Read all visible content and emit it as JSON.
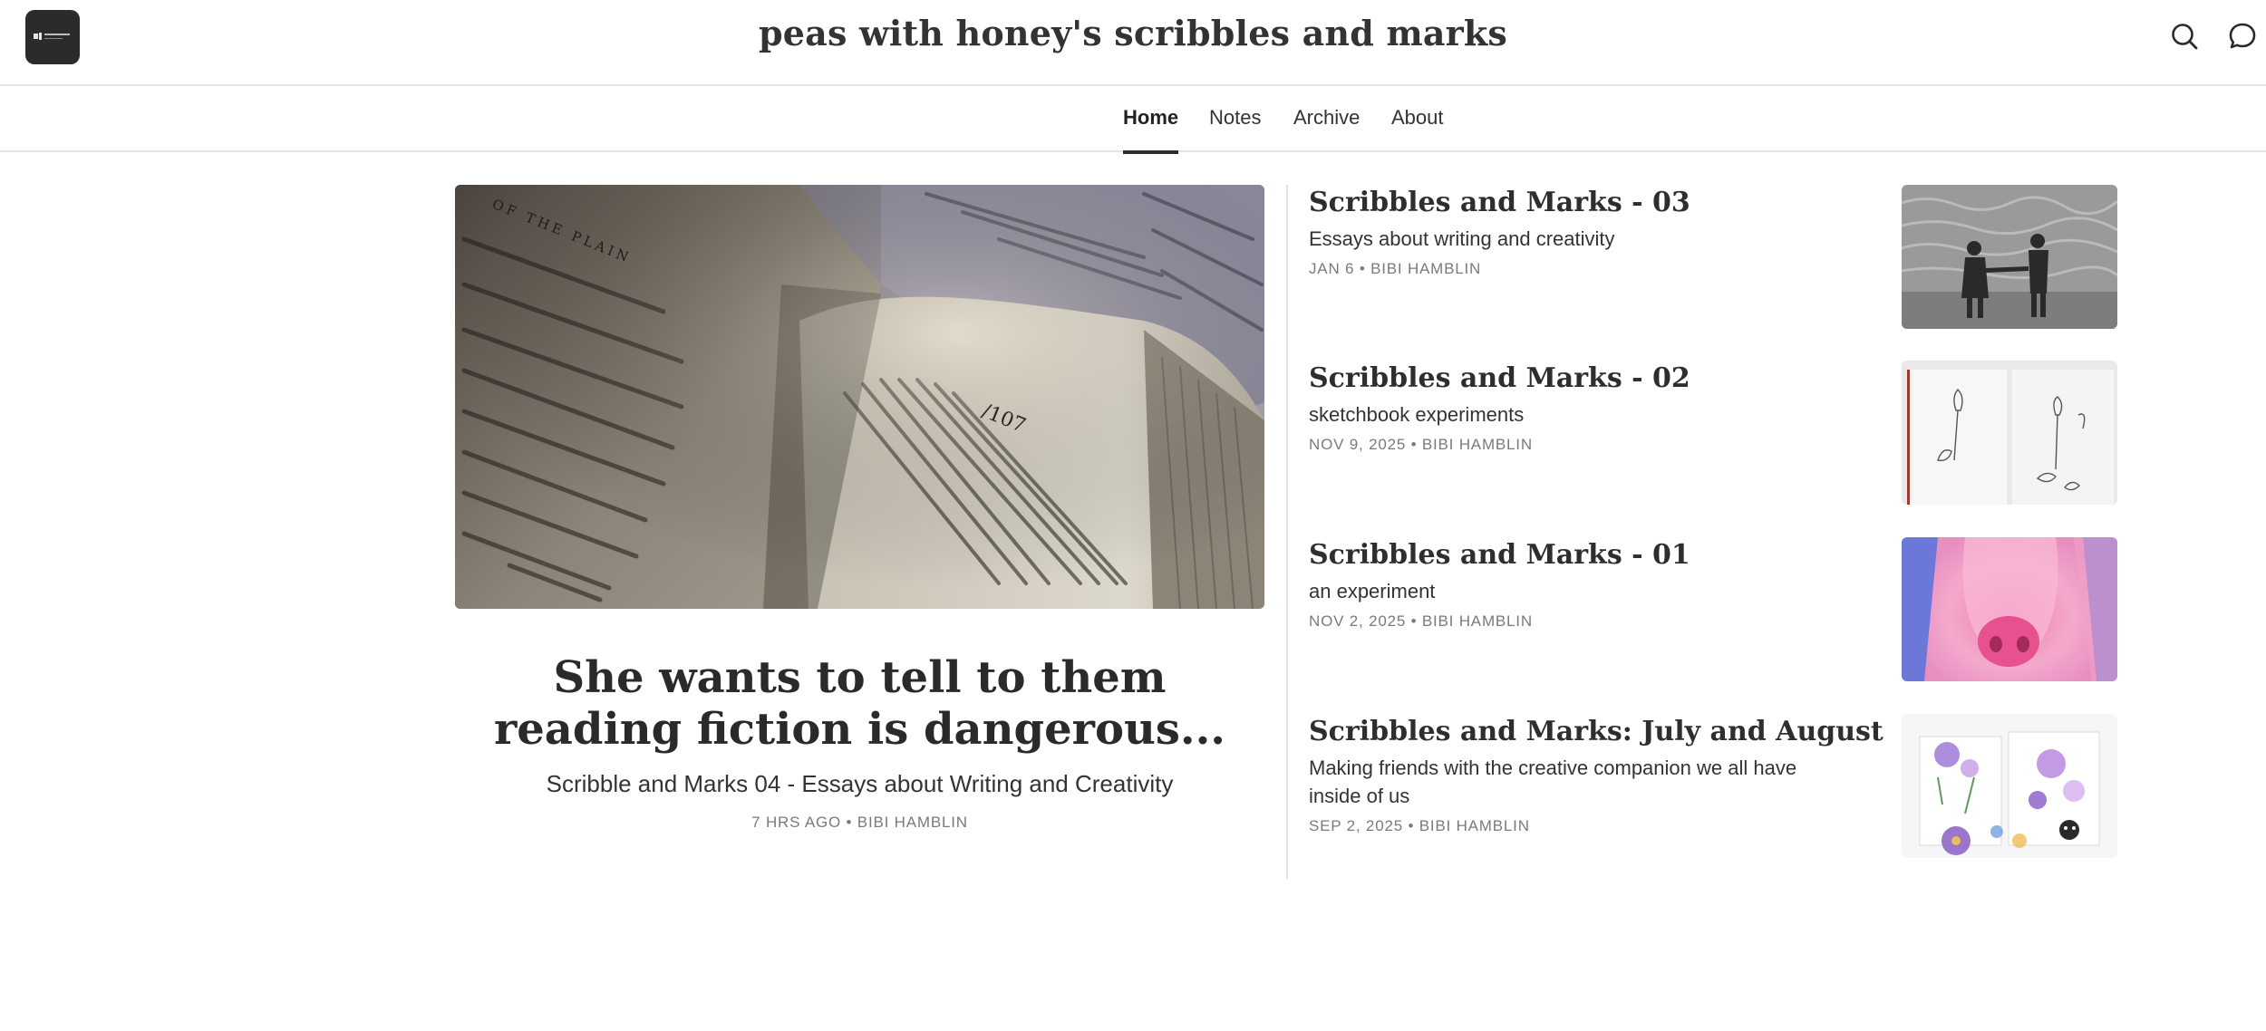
{
  "header": {
    "site_title": "peas with honey's scribbles and marks",
    "logo_icon": "publication-logo",
    "search_icon": "search-icon",
    "chat_icon": "chat-bubble-icon"
  },
  "nav": {
    "items": [
      {
        "label": "Home",
        "active": true
      },
      {
        "label": "Notes",
        "active": false
      },
      {
        "label": "Archive",
        "active": false
      },
      {
        "label": "About",
        "active": false
      }
    ]
  },
  "featured": {
    "title_line1": "She wants to tell to them",
    "title_line2": "reading fiction is dangerous...",
    "subtitle": "Scribble and Marks 04 - Essays about Writing and Creativity",
    "meta": "7 HRS AGO • BIBI HAMBLIN",
    "image_page_number": "/107",
    "image_chapter": "OF THE PLAIN"
  },
  "posts": [
    {
      "title": "Scribbles and Marks - 03",
      "subtitle": "Essays about writing and creativity",
      "meta": "JAN 6 • BIBI HAMBLIN"
    },
    {
      "title": "Scribbles and Marks - 02",
      "subtitle": "sketchbook experiments",
      "meta": "NOV 9, 2025 • BIBI HAMBLIN"
    },
    {
      "title": "Scribbles and Marks - 01",
      "subtitle": "an experiment",
      "meta": "NOV 2, 2025 • BIBI HAMBLIN"
    },
    {
      "title": "Scribbles and Marks: July and August",
      "subtitle": "Making friends with the creative companion we all have inside of us",
      "meta": "SEP 2, 2025 • BIBI HAMBLIN"
    }
  ],
  "colors": {
    "text": "#2a2a2a",
    "meta": "#7a7a7a",
    "border": "#e4e4e4",
    "logo_bg": "#2b2b2b"
  }
}
